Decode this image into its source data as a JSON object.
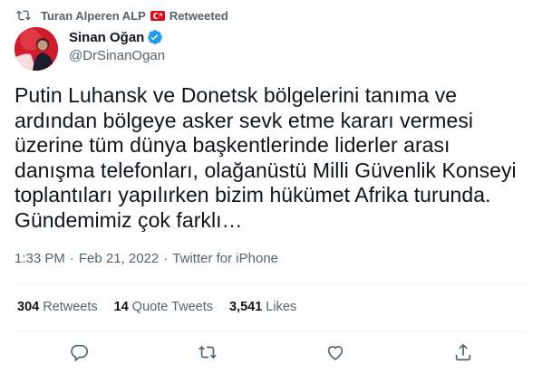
{
  "retweet_banner": {
    "name": "Turan Alperen ALP",
    "label": "Retweeted"
  },
  "author": {
    "display_name": "Sinan Oğan",
    "handle": "@DrSinanOgan"
  },
  "tweet": {
    "lines": [
      "Putin Luhansk ve Donetsk bölgelerini tanıma ve",
      "ardından bölgeye asker sevk etme kararı vermesi",
      "üzerine tüm dünya başkentlerinde liderler arası",
      "danışma telefonları, olağanüstü Milli Güvenlik Konseyi",
      "toplantıları yapılırken bizim hükümet Afrika turunda.",
      "Gündemimiz çok farklı…"
    ]
  },
  "meta": {
    "time": "1:33 PM",
    "separator": "·",
    "date": "Feb 21, 2022",
    "source": "Twitter for iPhone"
  },
  "stats": {
    "retweets_count": "304",
    "retweets_label": "Retweets",
    "quotes_count": "14",
    "quotes_label": "Quote Tweets",
    "likes_count": "3,541",
    "likes_label": "Likes"
  },
  "colors": {
    "text": "#0f1419",
    "secondary": "#536471",
    "verified": "#1d9bf0",
    "divider": "#eff3f4"
  },
  "icons": [
    "retweet-icon",
    "turkey-flag-icon",
    "verified-badge-icon",
    "reply-icon",
    "retweet-action-icon",
    "like-icon",
    "share-icon"
  ]
}
